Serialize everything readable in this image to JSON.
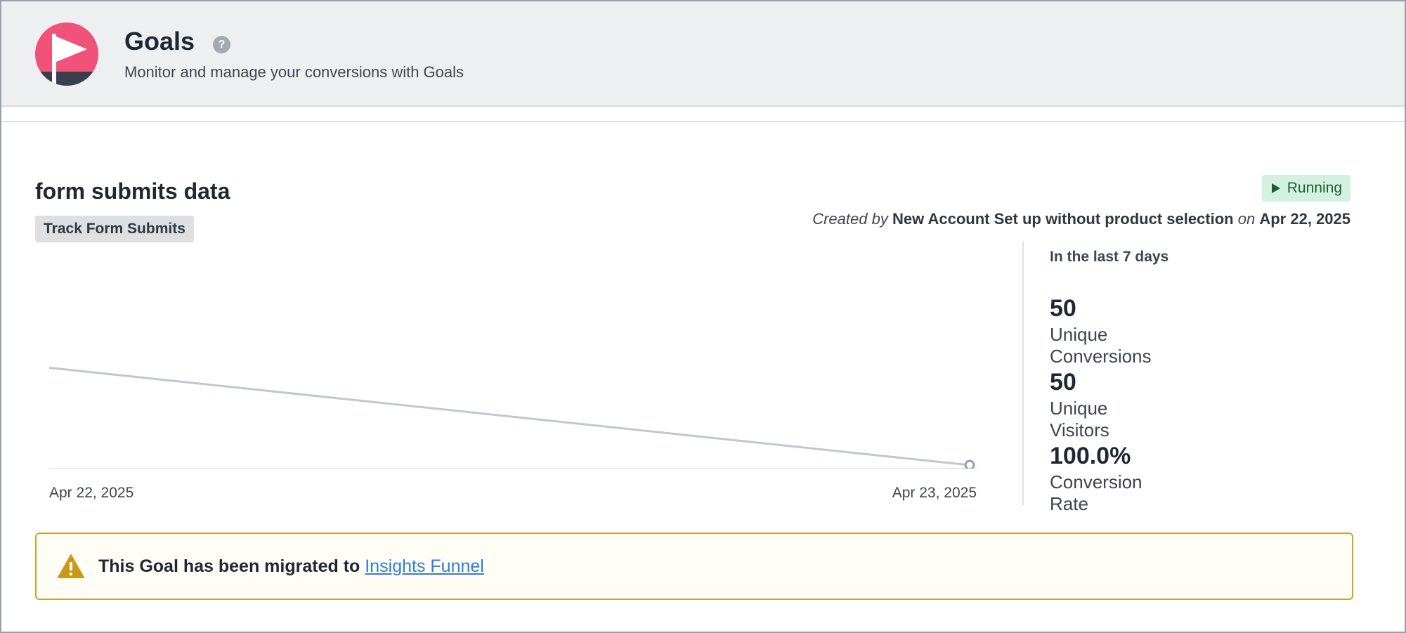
{
  "header": {
    "title": "Goals",
    "help_icon": "question-circle-icon",
    "help_glyph": "?",
    "subtitle": "Monitor and manage your conversions with Goals",
    "logo_icon": "flag-icon",
    "logo_color": "#f0527a"
  },
  "goal": {
    "name": "form submits data",
    "tag": "Track Form Submits",
    "status": "Running",
    "status_color": "#1c5b35",
    "created_prefix": "Created by",
    "created_by": "New Account Set up without product selection",
    "created_on_word": "on",
    "created_date": "Apr 22, 2025"
  },
  "chart_data": {
    "type": "line",
    "x": [
      "Apr 22, 2025",
      "Apr 23, 2025"
    ],
    "series": [
      {
        "values": [
          0.22,
          0.0
        ]
      }
    ],
    "grid": false,
    "line_color": "#c2c7cf"
  },
  "stats": {
    "heading": "In the last 7 days",
    "items": [
      {
        "value": "50",
        "label": "Unique Conversions"
      },
      {
        "value": "50",
        "label": "Unique Visitors"
      },
      {
        "value": "100.0%",
        "label": "Conversion Rate"
      }
    ]
  },
  "notice": {
    "icon": "warning-triangle-icon",
    "text": "This Goal has been migrated to",
    "link": "Insights Funnel",
    "border_color": "#c9a227"
  }
}
